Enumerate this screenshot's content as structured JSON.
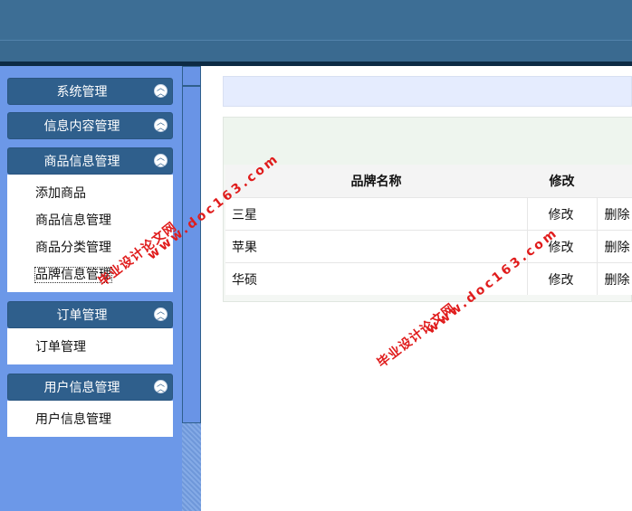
{
  "sidebar": {
    "panels": [
      {
        "title": "系统管理",
        "items": []
      },
      {
        "title": "信息内容管理",
        "items": []
      },
      {
        "title": "商品信息管理",
        "items": [
          "添加商品",
          "商品信息管理",
          "商品分类管理",
          "品牌信息管理"
        ]
      },
      {
        "title": "订单管理",
        "items": [
          "订单管理"
        ]
      },
      {
        "title": "用户信息管理",
        "items": [
          "用户信息管理"
        ]
      }
    ],
    "collapse_icon": "double-chevron-up-icon"
  },
  "table": {
    "headers": [
      "品牌名称",
      "修改",
      ""
    ],
    "rows": [
      {
        "name": "三星",
        "edit": "修改",
        "del": "删除"
      },
      {
        "name": "苹果",
        "edit": "修改",
        "del": "删除"
      },
      {
        "name": "华硕",
        "edit": "修改",
        "del": "删除"
      }
    ]
  },
  "watermark": {
    "line1": "毕业设计论文网",
    "line2": "www.doc163.com"
  },
  "colors": {
    "header": "#3d6e95",
    "sidebar": "#6c98e8",
    "panel_head": "#2f5f8c",
    "watermark": "#e01c1c"
  }
}
